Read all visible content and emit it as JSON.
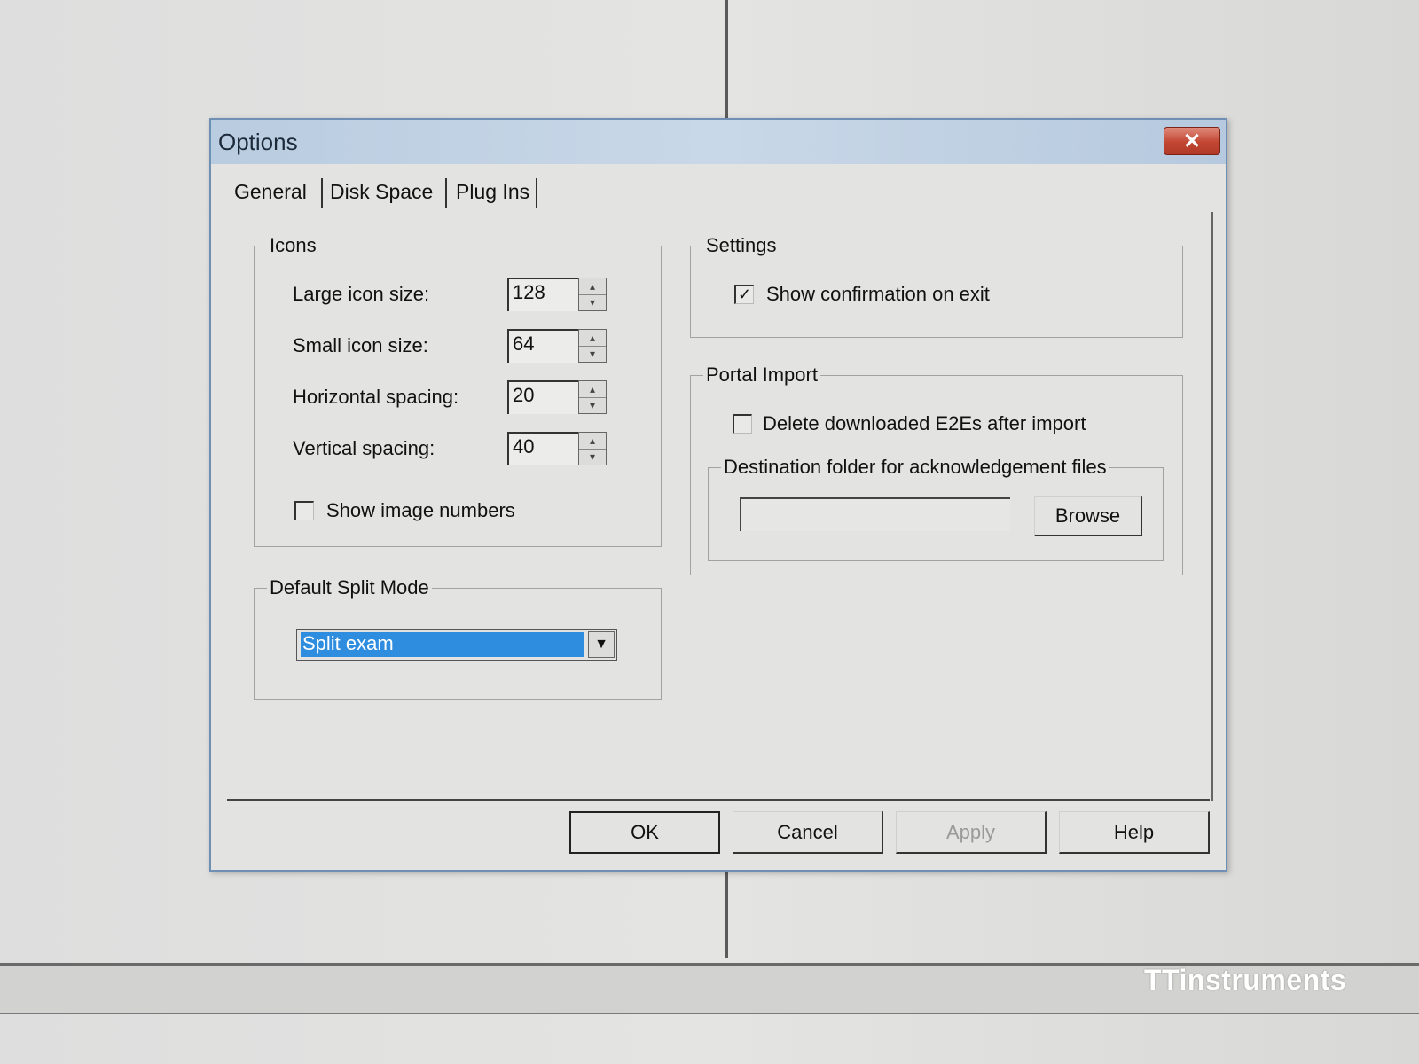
{
  "dialog": {
    "title": "Options",
    "close_symbol": "✕"
  },
  "tabs": [
    {
      "label": "General",
      "active": true
    },
    {
      "label": "Disk Space",
      "active": false
    },
    {
      "label": "Plug Ins",
      "active": false
    }
  ],
  "icons_group": {
    "label": "Icons",
    "fields": [
      {
        "label": "Large icon size:",
        "value": "128"
      },
      {
        "label": "Small icon size:",
        "value": "64"
      },
      {
        "label": "Horizontal spacing:",
        "value": "20"
      },
      {
        "label": "Vertical spacing:",
        "value": "40"
      }
    ],
    "show_image_numbers": {
      "label": "Show image numbers",
      "checked": false
    }
  },
  "split_mode_group": {
    "label": "Default Split Mode",
    "selected": "Split exam"
  },
  "settings_group": {
    "label": "Settings",
    "show_confirmation": {
      "label": "Show confirmation on exit",
      "checked": true,
      "mark": "✓"
    }
  },
  "portal_import_group": {
    "label": "Portal Import",
    "delete_downloaded": {
      "label": "Delete downloaded E2Es after import",
      "checked": false
    },
    "destination": {
      "label": "Destination folder for acknowledgement files",
      "value": "",
      "browse_label": "Browse"
    }
  },
  "buttons": {
    "ok": "OK",
    "cancel": "Cancel",
    "apply": "Apply",
    "help": "Help"
  },
  "watermark": "TTinstruments"
}
